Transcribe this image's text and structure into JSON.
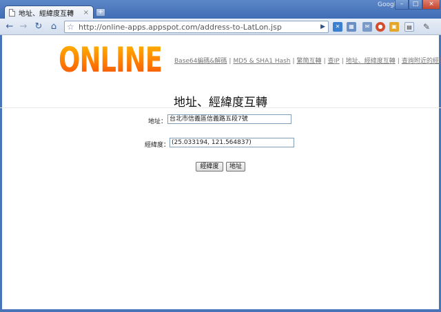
{
  "browser": {
    "tab_title": "地址、經緯度互轉",
    "tab_close": "×",
    "new_tab": "+",
    "google_label": "Google",
    "window_buttons": [
      "–",
      "□",
      "×"
    ],
    "url": "http://online-apps.appspot.com/address-to-LatLon.jsp",
    "nav": {
      "back": "←",
      "forward": "→",
      "reload": "↻",
      "home": "⌂",
      "star": "☆",
      "go": "▶"
    },
    "extension_icons": [
      "puzzle-icon",
      "calendar-icon",
      "mail-icon",
      "chrome-icon",
      "image-icon",
      "page-menu-icon",
      "wrench-icon"
    ]
  },
  "site": {
    "logo": "ONLINE APPS",
    "nav_links": [
      "Base64編碼&解碼",
      "MD5 & SHA1 Hash",
      "繁簡互轉",
      "查IP",
      "地址、經緯度互轉",
      "查詢附近的經緯度"
    ]
  },
  "main": {
    "title": "地址、經緯度互轉",
    "address_label": "地址：",
    "address_value": "台北市信義區信義路五段7號",
    "latlon_label": "經緯度：",
    "latlon_value": "(25.033194, 121.564837)",
    "to_latlon_button": "經緯度",
    "to_address_button": "地址"
  },
  "colors": {
    "chrome_blue": "#4a74b8",
    "logo_orange": "#ff8a00",
    "link_gray": "#777777"
  }
}
